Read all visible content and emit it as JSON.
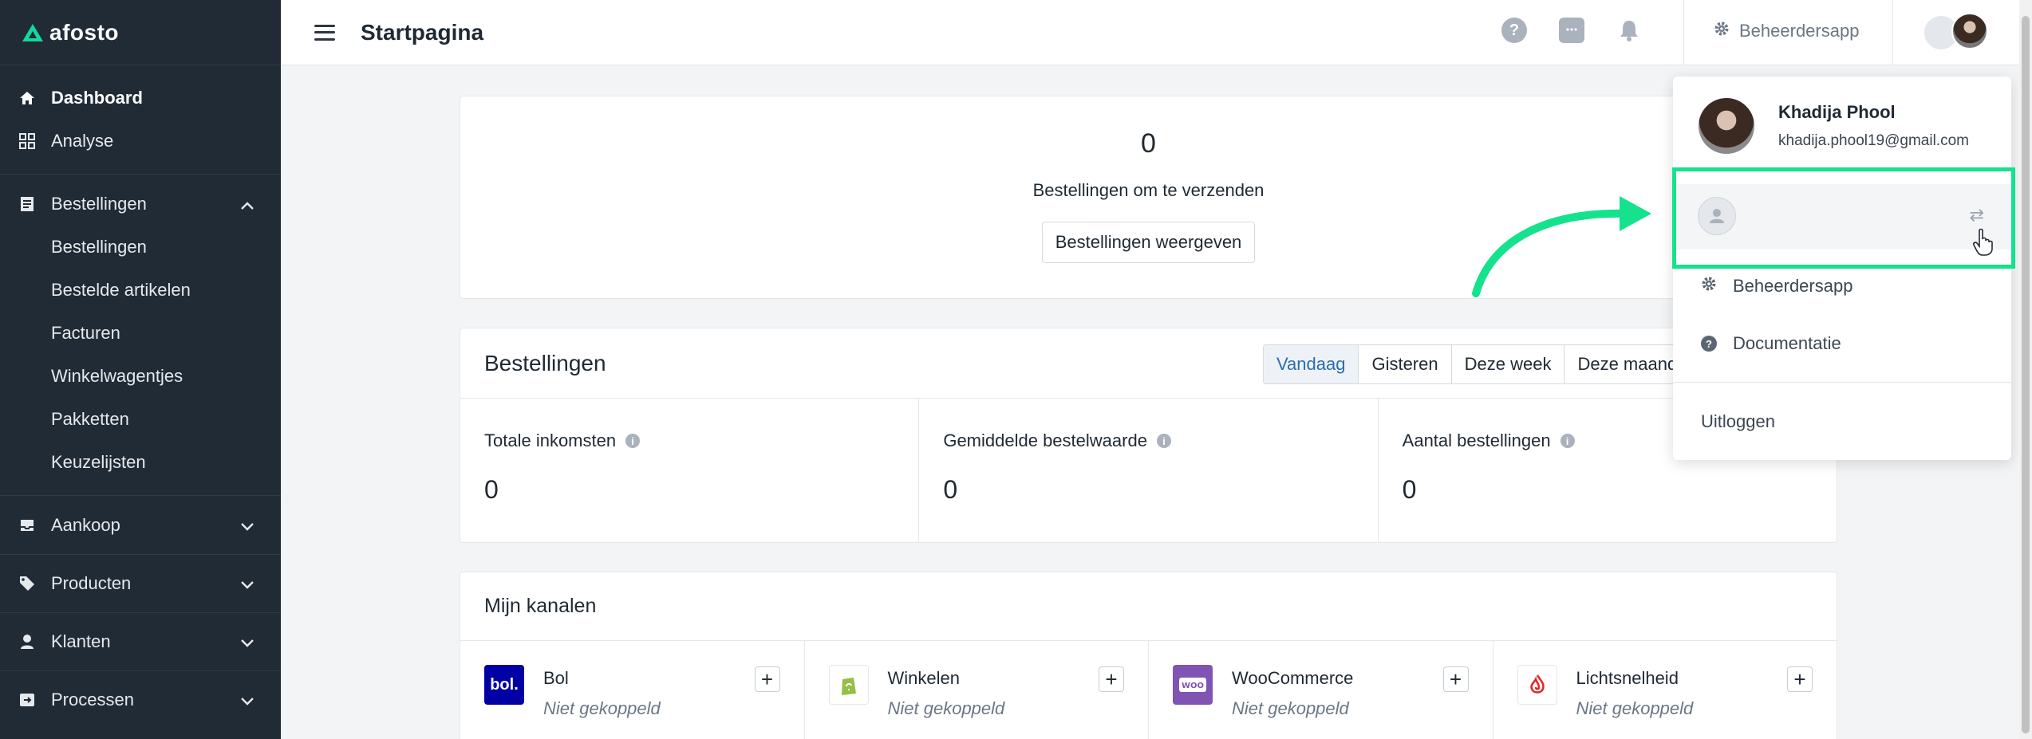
{
  "brand": {
    "name": "afosto",
    "accent": "#14d89b"
  },
  "sidebar": {
    "primary": [
      {
        "label": "Dashboard",
        "icon": "home-icon",
        "active": true
      },
      {
        "label": "Analyse",
        "icon": "grid-icon"
      }
    ],
    "orders": {
      "label": "Bestellingen",
      "icon": "receipt-icon",
      "children": [
        "Bestellingen",
        "Bestelde artikelen",
        "Facturen",
        "Winkelwagentjes",
        "Pakketten",
        "Keuzelijsten"
      ]
    },
    "sections": [
      {
        "label": "Aankoop",
        "icon": "inbox-icon"
      },
      {
        "label": "Producten",
        "icon": "tag-icon"
      },
      {
        "label": "Klanten",
        "icon": "user-icon"
      },
      {
        "label": "Processen",
        "icon": "process-icon"
      }
    ]
  },
  "header": {
    "title": "Startpagina",
    "admin_label": "Beheerdersapp"
  },
  "shipping": {
    "count": "0",
    "label": "Bestellingen om te verzenden",
    "button": "Bestellingen weergeven"
  },
  "orders_card": {
    "title": "Bestellingen",
    "tabs": [
      "Vandaag",
      "Gisteren",
      "Deze week",
      "Deze maand"
    ],
    "active_tab": "Vandaag",
    "stats": [
      {
        "label": "Totale inkomsten",
        "value": "0"
      },
      {
        "label": "Gemiddelde bestelwaarde",
        "value": "0"
      },
      {
        "label": "Aantal bestellingen",
        "value": "0"
      }
    ]
  },
  "channels_card": {
    "title": "Mijn kanalen",
    "channels": [
      {
        "name": "Bol",
        "status": "Niet gekoppeld",
        "logo": "bol.",
        "color": "#0000a4"
      },
      {
        "name": "Winkelen",
        "status": "Niet gekoppeld",
        "logo": "shopify",
        "color": "#ffffff"
      },
      {
        "name": "WooCommerce",
        "status": "Niet gekoppeld",
        "logo": "woo",
        "color": "#7f54b3"
      },
      {
        "name": "Lichtsnelheid",
        "status": "Niet gekoppeld",
        "logo": "flame",
        "color": "#ffffff"
      }
    ]
  },
  "user_menu": {
    "name": "Khadija Phool",
    "email": "khadija.phool19@gmail.com",
    "items": [
      "Beheerdersapp",
      "Documentatie"
    ],
    "logout": "Uitloggen",
    "highlight_color": "#14e28d"
  }
}
